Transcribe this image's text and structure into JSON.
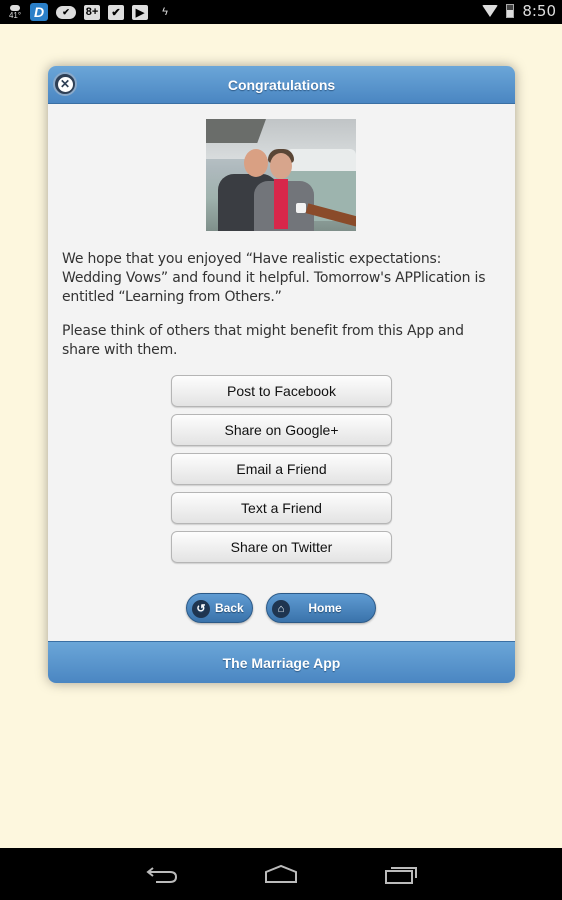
{
  "status_bar": {
    "temperature": "41°",
    "notification_icons": [
      "weather-icon",
      "d-app-icon",
      "cloud-check-icon",
      "google-plus-icon",
      "store-check-icon",
      "play-store-icon",
      "flash-icon"
    ],
    "d_label": "D",
    "gplus_label": "8+",
    "time": "8:50"
  },
  "dialog": {
    "title": "Congratulations",
    "close_label": "✕",
    "photo_alt": "Couple on cruise ship deck with glacier behind",
    "message1": "We hope that you enjoyed “Have realistic expectations: Wedding Vows” and found it helpful. Tomorrow's APPlication is entitled “Learning from Others.”",
    "message2": "Please think of others that might benefit from this App and share with them.",
    "share_buttons": [
      {
        "label": "Post to Facebook"
      },
      {
        "label": "Share on Google+"
      },
      {
        "label": "Email a Friend"
      },
      {
        "label": "Text a Friend"
      },
      {
        "label": "Share on Twitter"
      }
    ],
    "back_label": "Back",
    "home_label": "Home",
    "footer": "The Marriage App"
  },
  "colors": {
    "background": "#fdf7de",
    "header_blue": "#4a86c2",
    "panel": "#f3f3f3"
  }
}
